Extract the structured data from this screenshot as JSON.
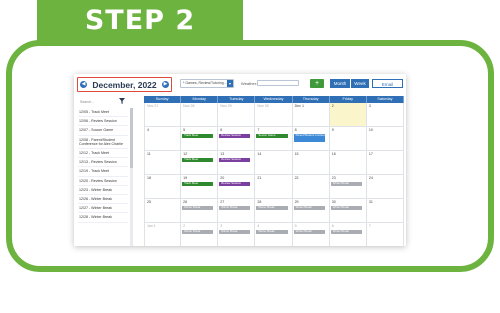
{
  "banner": {
    "label": "STEP 2"
  },
  "toolbar": {
    "month_title": "December, 2022",
    "prev_arrow": "◀",
    "next_arrow": "▶",
    "calendar_select": "* Games, Review/Tutoring...",
    "weather_label": "Weather:",
    "add_label": "+",
    "view_month": "Month",
    "view_week": "Week",
    "view_email": "Email"
  },
  "sidebar": {
    "search_placeholder": "Search...",
    "items": [
      "12/05 - Track Meet",
      "12/06 - Review Session",
      "12/07 - Soccer Game",
      "12/08 - Parent/Student Conference for Alex Charlie",
      "12/12 - Track Meet",
      "12/13 - Review Session",
      "12/19 - Track Meet",
      "12/20 - Review Session",
      "12/23 - Winter Break",
      "12/26 - Winter Break",
      "12/27 - Winter Break",
      "12/28 - Winter Break"
    ]
  },
  "calendar": {
    "days": [
      "Sunday",
      "Monday",
      "Tuesday",
      "Wednesday",
      "Thursday",
      "Friday",
      "Saturday"
    ],
    "weeks": [
      [
        {
          "d": "Nov 27",
          "o": true
        },
        {
          "d": "Nov 28",
          "o": true
        },
        {
          "d": "Nov 29",
          "o": true
        },
        {
          "d": "Nov 30",
          "o": true
        },
        {
          "d": "Dec 1"
        },
        {
          "d": "2",
          "today": true
        },
        {
          "d": "3"
        }
      ],
      [
        {
          "d": "4"
        },
        {
          "d": "5",
          "ev": [
            [
              "Track Meet",
              "green"
            ]
          ]
        },
        {
          "d": "6",
          "ev": [
            [
              "Review Session",
              "purple"
            ]
          ]
        },
        {
          "d": "7",
          "ev": [
            [
              "Soccer Game",
              "green"
            ]
          ]
        },
        {
          "d": "8",
          "ev": [
            [
              "Parent/Student Conference for Alex Charlie",
              "blue"
            ]
          ]
        },
        {
          "d": "9"
        },
        {
          "d": "10"
        }
      ],
      [
        {
          "d": "11"
        },
        {
          "d": "12",
          "ev": [
            [
              "Track Meet",
              "green"
            ]
          ]
        },
        {
          "d": "13",
          "ev": [
            [
              "Review Session",
              "purple"
            ]
          ]
        },
        {
          "d": "14"
        },
        {
          "d": "15"
        },
        {
          "d": "16"
        },
        {
          "d": "17"
        }
      ],
      [
        {
          "d": "18"
        },
        {
          "d": "19",
          "ev": [
            [
              "Track Meet",
              "green"
            ]
          ]
        },
        {
          "d": "20",
          "ev": [
            [
              "Review Session",
              "purple"
            ]
          ]
        },
        {
          "d": "21"
        },
        {
          "d": "22"
        },
        {
          "d": "23",
          "ev": [
            [
              "Winter Break",
              "grey"
            ]
          ]
        },
        {
          "d": "24"
        }
      ],
      [
        {
          "d": "25"
        },
        {
          "d": "26",
          "ev": [
            [
              "Winter Break",
              "grey"
            ]
          ]
        },
        {
          "d": "27",
          "ev": [
            [
              "Winter Break",
              "grey"
            ]
          ]
        },
        {
          "d": "28",
          "ev": [
            [
              "Winter Break",
              "grey"
            ]
          ]
        },
        {
          "d": "29",
          "ev": [
            [
              "Winter Break",
              "grey"
            ]
          ]
        },
        {
          "d": "30",
          "ev": [
            [
              "Winter Break",
              "grey"
            ]
          ]
        },
        {
          "d": "31"
        }
      ],
      [
        {
          "d": "Jan 1",
          "o": true
        },
        {
          "d": "2",
          "o": true,
          "ev": [
            [
              "Winter Break",
              "grey"
            ]
          ]
        },
        {
          "d": "3",
          "o": true,
          "ev": [
            [
              "Winter Break",
              "grey"
            ]
          ]
        },
        {
          "d": "4",
          "o": true,
          "ev": [
            [
              "Winter Break",
              "grey"
            ]
          ]
        },
        {
          "d": "5",
          "o": true,
          "ev": [
            [
              "Winter Break",
              "grey"
            ]
          ]
        },
        {
          "d": "6",
          "o": true,
          "ev": [
            [
              "Winter Break",
              "grey"
            ]
          ]
        },
        {
          "d": "7",
          "o": true
        }
      ]
    ]
  },
  "colors": {
    "brand_green": "#6db33f",
    "accent_blue": "#2f6fb6",
    "highlight_red": "#e04a3a"
  }
}
